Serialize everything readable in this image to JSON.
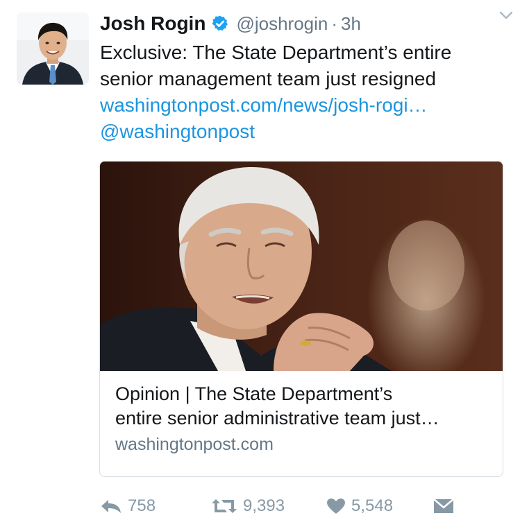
{
  "tweet": {
    "author": {
      "display_name": "Josh Rogin",
      "verified": true,
      "handle": "@joshrogin",
      "separator": "·",
      "timestamp": "3h"
    },
    "text_lines": [
      "Exclusive: The State Department’s entire",
      "senior management team just resigned"
    ],
    "link_text": "washingtonpost.com/news/josh-rogi…",
    "mention": "@washingtonpost",
    "card": {
      "title_lines": [
        "Opinion | The State Department’s",
        "entire senior administrative team just…"
      ],
      "domain": "washingtonpost.com"
    },
    "actions": {
      "replies": "758",
      "retweets": "9,393",
      "likes": "5,548"
    }
  },
  "colors": {
    "link_blue": "#1b95e0",
    "secondary_text": "#657786",
    "action_gray": "#8899a6",
    "card_border": "#d7dde2"
  },
  "icons": {
    "verified": "verified-badge-icon",
    "caret": "chevron-down-icon",
    "reply": "reply-icon",
    "retweet": "retweet-icon",
    "like": "heart-icon",
    "message": "envelope-icon"
  }
}
